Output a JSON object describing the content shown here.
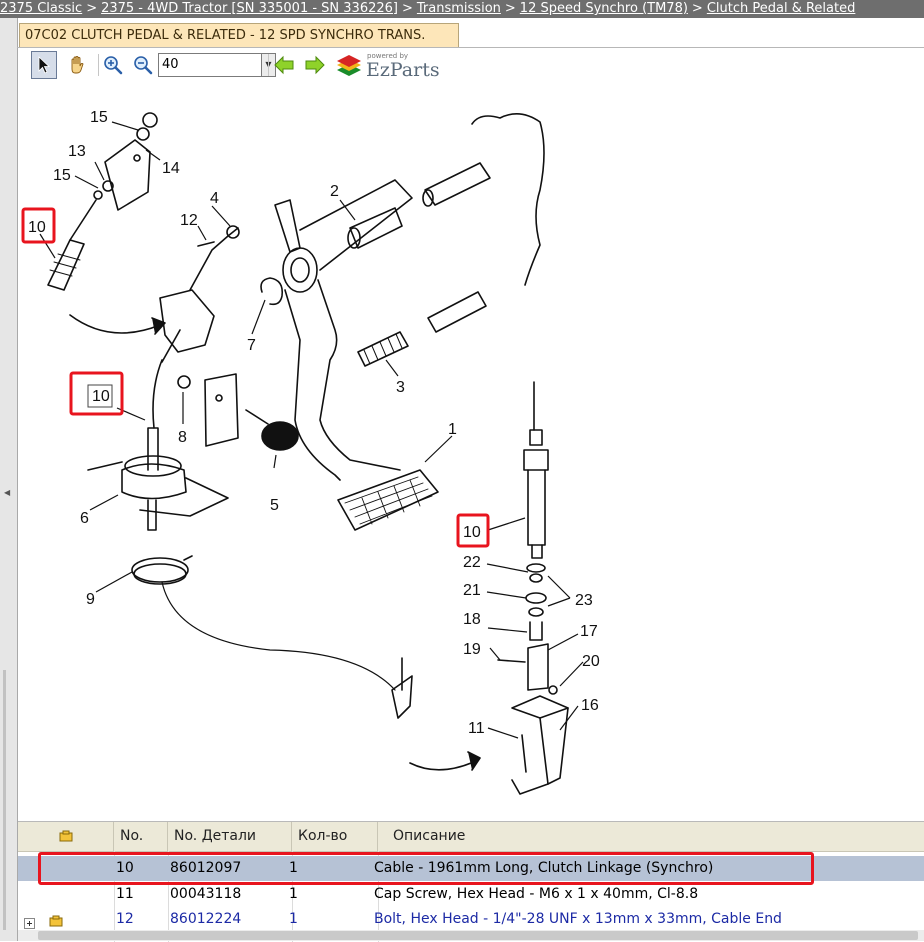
{
  "breadcrumb": [
    {
      "label": "2375 Classic"
    },
    {
      "label": "2375 - 4WD Tractor [SN 335001 - SN 336226]"
    },
    {
      "label": "Transmission"
    },
    {
      "label": "12 Speed Synchro (TM78)"
    },
    {
      "label": "Clutch Pedal & Related"
    }
  ],
  "breadcrumb_separator": ">",
  "tab": {
    "title": "07C02 CLUTCH PEDAL & RELATED - 12 SPD SYNCHRO TRANS."
  },
  "toolbar": {
    "tools": [
      {
        "name": "select-pointer",
        "icon": "arrow-cursor-icon"
      },
      {
        "name": "pan-hand",
        "icon": "hand-icon"
      },
      {
        "name": "zoom-in",
        "icon": "zoom-in-icon"
      },
      {
        "name": "zoom-out",
        "icon": "zoom-out-icon"
      },
      {
        "name": "previous",
        "icon": "arrow-left-icon"
      },
      {
        "name": "next",
        "icon": "arrow-right-icon"
      }
    ],
    "zoom_value": "40",
    "logo": {
      "powered_by": "powered by",
      "brand": "EzParts"
    }
  },
  "diagram": {
    "callouts": [
      "1",
      "2",
      "3",
      "4",
      "5",
      "6",
      "7",
      "8",
      "9",
      "10",
      "10",
      "10",
      "11",
      "12",
      "13",
      "14",
      "15",
      "15",
      "16",
      "17",
      "18",
      "19",
      "20",
      "21",
      "22",
      "23"
    ],
    "highlighted_callout": "10"
  },
  "grid": {
    "columns": [
      "No.",
      "No. Детали",
      "Кол-во",
      "Описание"
    ],
    "rows": [
      {
        "no": "10",
        "part": "86012097",
        "qty": "1",
        "desc": "Cable - 1961mm Long, Clutch Linkage (Synchro)",
        "selected": true
      },
      {
        "no": "11",
        "part": "00043118",
        "qty": "1",
        "desc": "Cap Screw, Hex Head - M6 x 1 x 40mm, Cl-8.8",
        "selected": false
      },
      {
        "no": "12",
        "part": "86012224",
        "qty": "1",
        "desc": "Bolt, Hex Head - 1/4\"-28 UNF x 13mm x 33mm, Cable End",
        "selected": false
      }
    ]
  },
  "colors": {
    "breadcrumb_bg": "#6e6e6e",
    "tab_bg": "#fde6b9",
    "selected_row": "#b6c2d5",
    "highlight": "#e8141e",
    "link_row": "#1c2aa5"
  }
}
